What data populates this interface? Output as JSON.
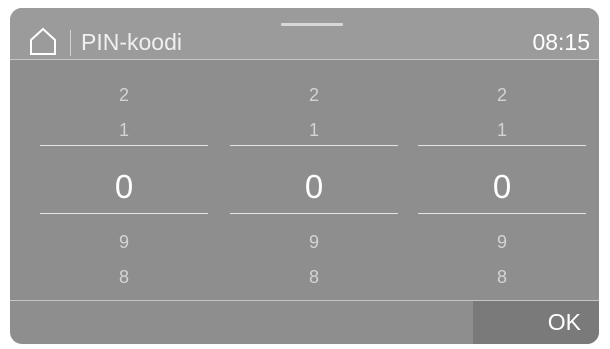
{
  "header": {
    "home_icon": "home-icon",
    "title": "PIN-koodi",
    "time": "08:15"
  },
  "picker": {
    "columns": [
      {
        "above2": "2",
        "above1": "1",
        "selected": "0",
        "below1": "9",
        "below2": "8"
      },
      {
        "above2": "2",
        "above1": "1",
        "selected": "0",
        "below1": "9",
        "below2": "8"
      },
      {
        "above2": "2",
        "above1": "1",
        "selected": "0",
        "below1": "9",
        "below2": "8"
      }
    ]
  },
  "footer": {
    "ok_label": "OK"
  },
  "colors": {
    "screen_bg": "#8e8e8e",
    "header_bg": "#9b9b9b",
    "ok_bg": "#7a7a7a",
    "text_primary": "#ffffff",
    "text_dim": "#d4d4d4"
  }
}
